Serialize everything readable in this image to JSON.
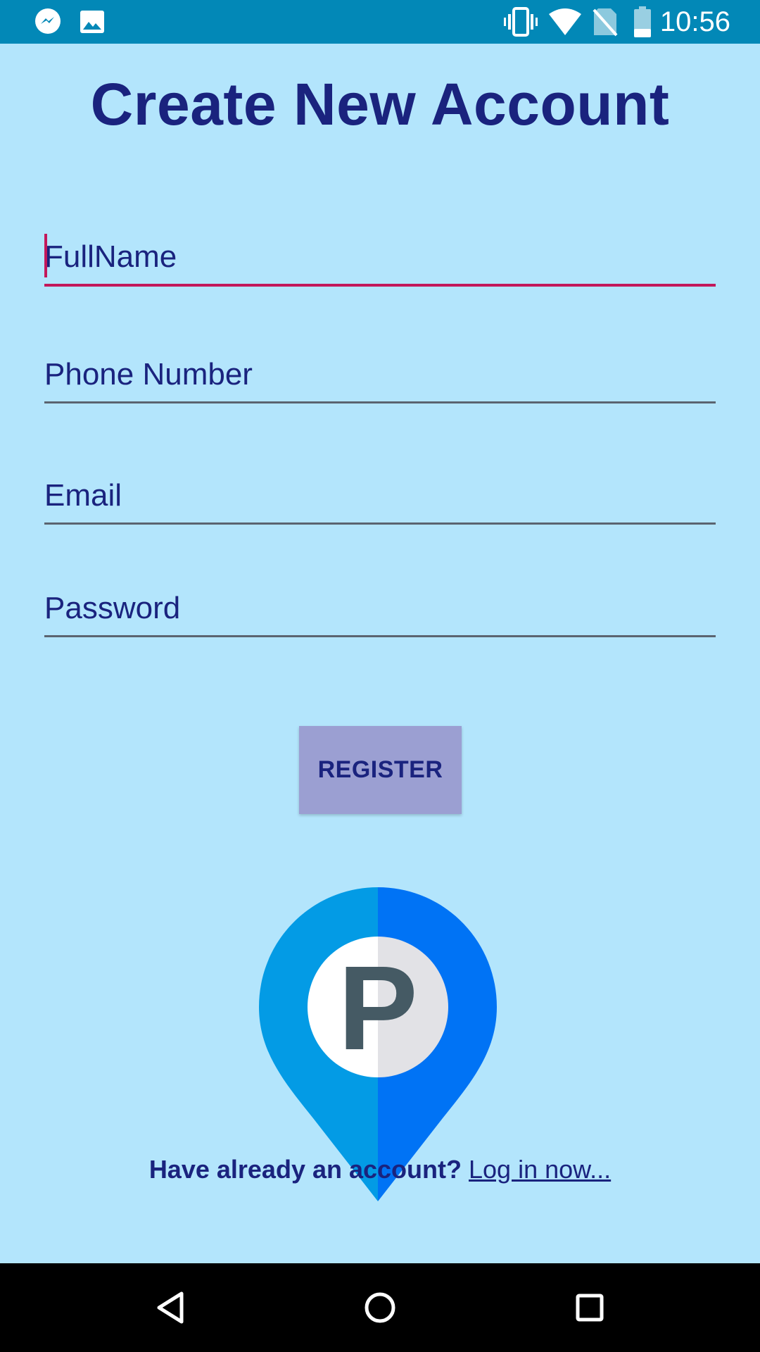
{
  "status_bar": {
    "time": "10:56",
    "left_icons": [
      "messenger-icon",
      "image-icon"
    ],
    "right_icons": [
      "vibrate-icon",
      "wifi-icon",
      "no-sim-icon",
      "battery-icon"
    ]
  },
  "title": "Create New Account",
  "form": {
    "fullname_placeholder": "FullName",
    "phone_placeholder": "Phone Number",
    "email_placeholder": "Email",
    "password_placeholder": "Password"
  },
  "register_label": "REGISTER",
  "logo_letter": "P",
  "login": {
    "question": "Have already an account?",
    "link": "Log in now..."
  },
  "colors": {
    "background": "#b3e5fc",
    "status_bar": "#0288b7",
    "title": "#1a237e",
    "focus_underline": "#c2185b",
    "button": "#9b9fd2"
  },
  "nav_icons": [
    "back-icon",
    "home-icon",
    "recents-icon"
  ]
}
